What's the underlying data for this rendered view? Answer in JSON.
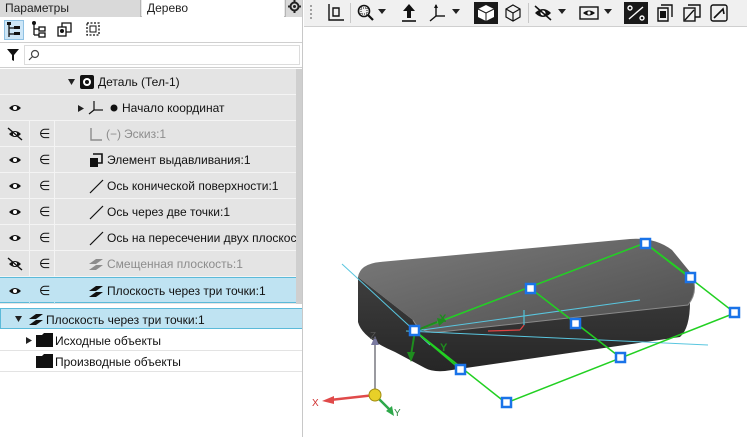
{
  "tabs": {
    "params": "Параметры",
    "tree": "Дерево"
  },
  "tree": {
    "root": "Деталь (Тел-1)",
    "rows": [
      {
        "label": "Начало координат",
        "dim": false,
        "visible": true
      },
      {
        "label": "Эскиз:1",
        "prefix": "(−)",
        "dim": true,
        "visible": false
      },
      {
        "label": "Элемент выдавливания:1",
        "dim": false,
        "visible": true
      },
      {
        "label": "Ось конической поверхности:1",
        "dim": false,
        "visible": true
      },
      {
        "label": "Ось через две точки:1",
        "dim": false,
        "visible": true
      },
      {
        "label": "Ось на пересечении двух плоскосте",
        "dim": false,
        "visible": true
      },
      {
        "label": "Смещенная плоскость:1",
        "dim": true,
        "visible": false
      },
      {
        "label": "Плоскость через три точки:1",
        "dim": false,
        "visible": true,
        "selected": true
      }
    ]
  },
  "bottom": {
    "title": "Плоскость через три точки:1",
    "items": [
      "Исходные объекты",
      "Производные объекты"
    ]
  },
  "triad": {
    "x": "X",
    "y": "Y",
    "z": "Z"
  },
  "plane_axes": {
    "x": "X",
    "y": "Y"
  },
  "colors": {
    "selection": "#bfe3f2",
    "plane": "#22d022",
    "handle": "#1a73e8",
    "body": "#5a5a5a"
  }
}
